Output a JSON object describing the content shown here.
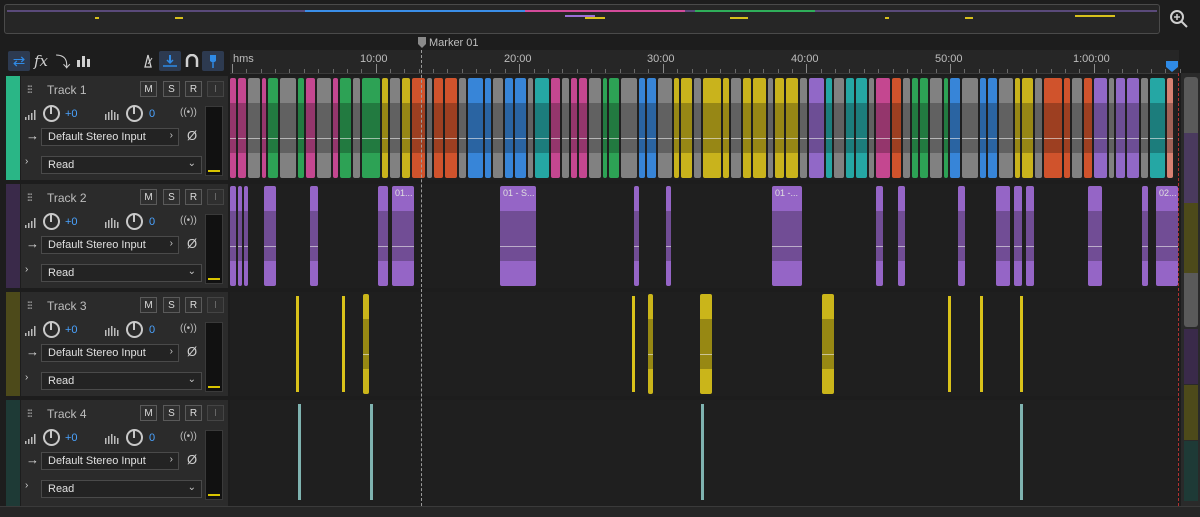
{
  "toolbar": {
    "buttons": [
      {
        "name": "switch-editor-icon",
        "glyph": "⇄",
        "active": true
      },
      {
        "name": "fx-icon",
        "glyph": "fx",
        "active": false
      },
      {
        "name": "sends-icon",
        "glyph": "⤵",
        "active": false
      },
      {
        "name": "eq-icon",
        "glyph": "▮▮",
        "active": false
      },
      {
        "name": "metronome-icon",
        "glyph": "⧍",
        "active": false
      },
      {
        "name": "time-selection-icon",
        "glyph": "⤧",
        "active": true
      },
      {
        "name": "snap-icon",
        "glyph": "∩",
        "active": false
      },
      {
        "name": "marker-icon",
        "glyph": "¶",
        "active": false
      }
    ]
  },
  "marker": {
    "label": "Marker 01"
  },
  "ruler": {
    "unit": "hms",
    "labels": [
      "10:00",
      "20:00",
      "30:00",
      "40:00",
      "50:00",
      "1:00:00"
    ]
  },
  "tracks": [
    {
      "name": "Track 1",
      "color": "#2ab686",
      "clip_color": "mixed",
      "m": "M",
      "s": "S",
      "r": "R",
      "i": "I",
      "volume": "+0",
      "pan": "0",
      "input": "Default Stereo Input",
      "automation": "Read"
    },
    {
      "name": "Track 2",
      "color": "#3a2a4a",
      "clip_color": "#a06cd5",
      "m": "M",
      "s": "S",
      "r": "R",
      "i": "I",
      "volume": "+0",
      "pan": "0",
      "input": "Default Stereo Input",
      "automation": "Read",
      "clip_labels": [
        "01...",
        "01 - S...",
        "01 -...",
        "02..."
      ]
    },
    {
      "name": "Track 3",
      "color": "#4d4a1a",
      "clip_color": "#d9c21a",
      "m": "M",
      "s": "S",
      "r": "R",
      "i": "I",
      "volume": "+0",
      "pan": "0",
      "input": "Default Stereo Input",
      "automation": "Read"
    },
    {
      "name": "Track 4",
      "color": "#1e3a36",
      "clip_color": "#7fb3b0",
      "m": "M",
      "s": "S",
      "r": "R",
      "i": "I",
      "volume": "+0",
      "pan": "0",
      "input": "Default Stereo Input",
      "automation": "Read"
    }
  ],
  "colors": {
    "accent_blue": "#2f8ae5",
    "track1_palette": [
      "#d34b9a",
      "#2fae5a",
      "#3a8ee8",
      "#d8c01c",
      "#e0582e",
      "#9b6fd6",
      "#26b3b0"
    ]
  }
}
